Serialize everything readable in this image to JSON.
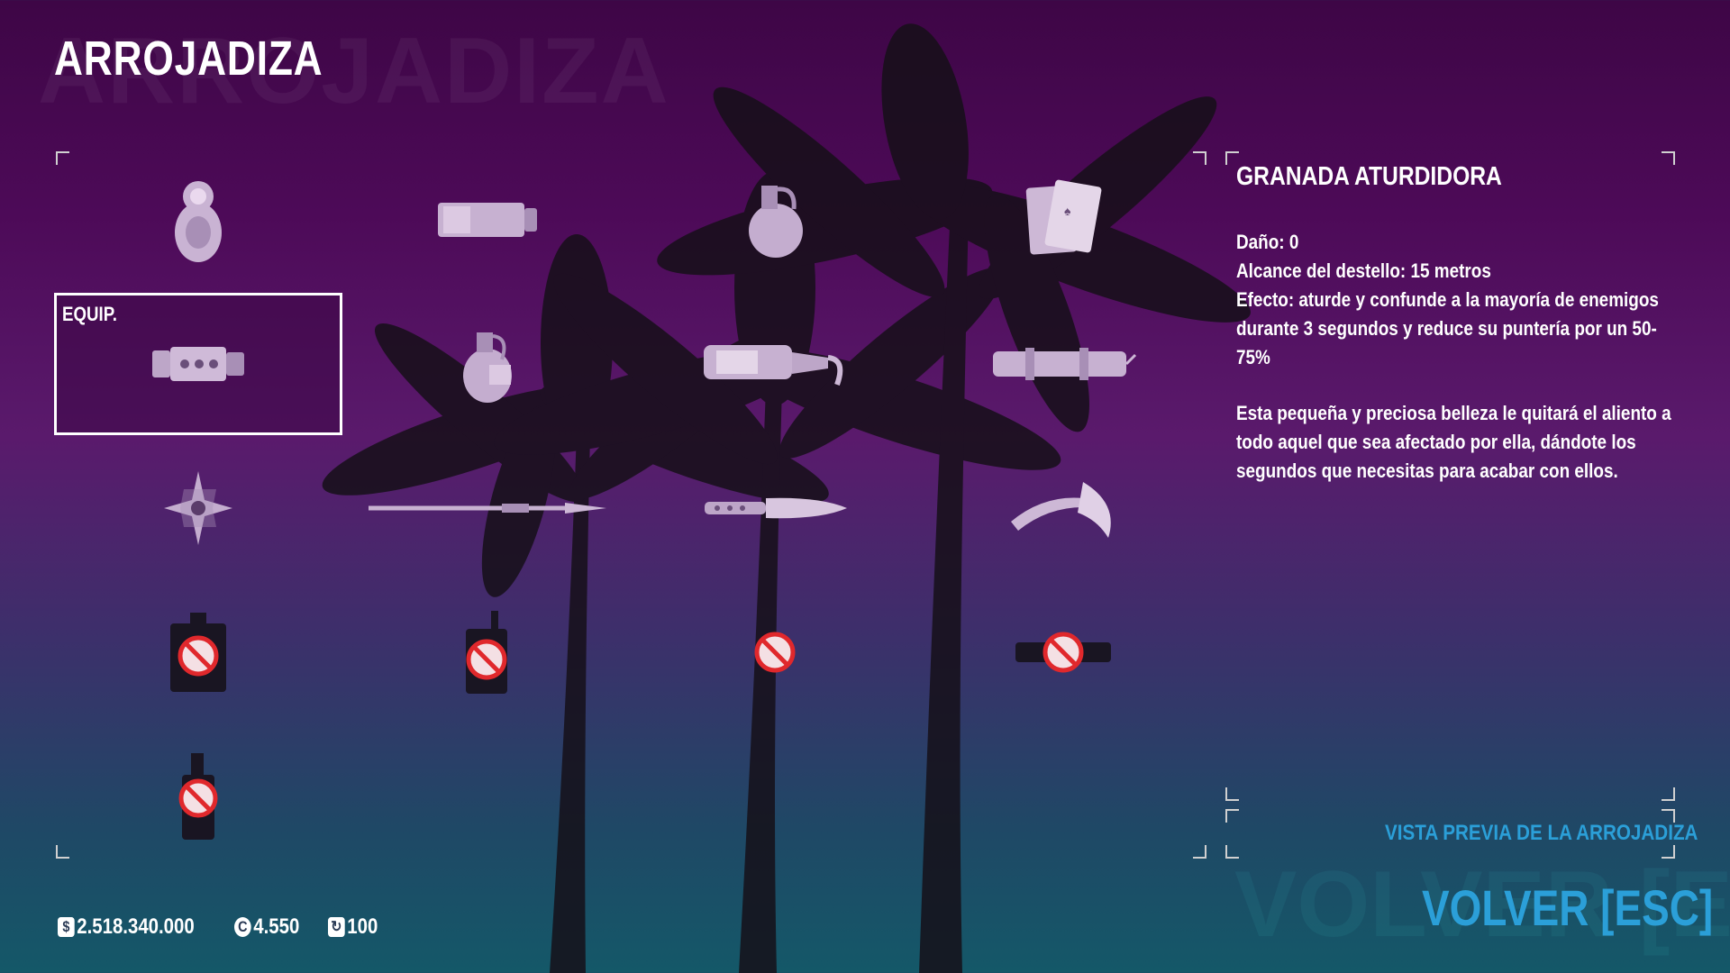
{
  "header": {
    "title": "ARROJADIZA",
    "title_ghost": "ARROJADIZA"
  },
  "grid": {
    "equipped_label": "EQUIP.",
    "items": [
      {
        "icon": "matryoshka-icon",
        "locked": false
      },
      {
        "icon": "smoke-canister-icon",
        "locked": false
      },
      {
        "icon": "frag-grenade-icon",
        "locked": false
      },
      {
        "icon": "playing-cards-icon",
        "locked": false
      },
      {
        "icon": "concussion-grenade-icon",
        "locked": false,
        "equipped": true
      },
      {
        "icon": "pineapple-grenade-icon",
        "locked": false
      },
      {
        "icon": "molotov-bottle-icon",
        "locked": false
      },
      {
        "icon": "dynamite-bundle-icon",
        "locked": false
      },
      {
        "icon": "shuriken-icon",
        "locked": false
      },
      {
        "icon": "javelin-icon",
        "locked": false
      },
      {
        "icon": "throwing-knife-icon",
        "locked": false
      },
      {
        "icon": "throwing-axe-icon",
        "locked": false
      },
      {
        "icon": "flask-icon",
        "locked": true
      },
      {
        "icon": "radio-icon",
        "locked": true
      },
      {
        "icon": "mine-icon",
        "locked": true
      },
      {
        "icon": "pipe-bomb-icon",
        "locked": true
      },
      {
        "icon": "spray-bottle-icon",
        "locked": true
      }
    ]
  },
  "details": {
    "name": "GRANADA ATURDIDORA",
    "stats": [
      "Daño: 0",
      "Alcance del destello: 15 metros",
      "Efecto: aturde y confunde a la mayoría de enemigos durante 3 segundos y reduce su puntería por un 50-75%"
    ],
    "description": "Esta pequeña y preciosa belleza le quitará el aliento a todo aquel que sea afectado por ella, dándote los segundos que necesitas para acabar con ellos."
  },
  "footer": {
    "preview_label": "VISTA PREVIA DE LA ARROJADIZA",
    "back_label": "VOLVER [ESC]",
    "back_ghost": "VOLVER [ESC]",
    "money": "2.518.340.000",
    "coins": "4.550",
    "level": "100"
  },
  "colors": {
    "accent": "#2b9fd8",
    "locked_red": "#e0282c"
  }
}
